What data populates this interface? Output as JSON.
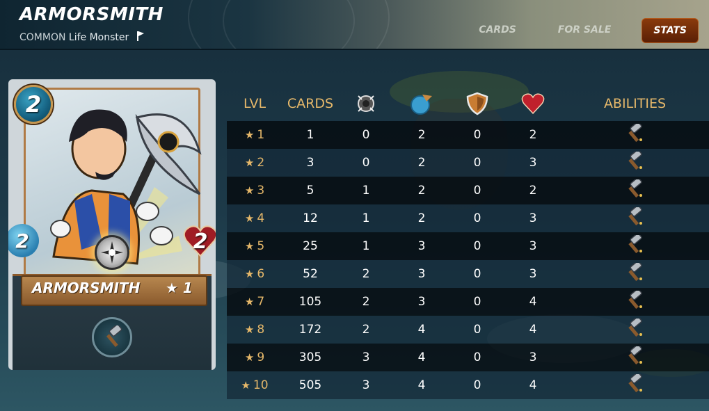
{
  "header": {
    "title": "ARMORSMITH",
    "rarity": "COMMON",
    "subtitle_rest": "Life Monster",
    "tabs": [
      {
        "label": "CARDS",
        "active": false
      },
      {
        "label": "FOR SALE",
        "active": false
      },
      {
        "label": "STATS",
        "active": true
      }
    ]
  },
  "card": {
    "name": "ARMORSMITH",
    "level": "★ 1",
    "mana": "2",
    "speed": "2",
    "health": "2",
    "element_icon": "life-element-icon",
    "ability_icon": "repair-hammer-icon"
  },
  "stats": {
    "headers": {
      "lvl": "LVL",
      "cards": "CARDS",
      "attack_icon": "melee-attack-icon",
      "speed_icon": "speed-icon",
      "armor_icon": "armor-shield-icon",
      "health_icon": "health-heart-icon",
      "abilities": "ABILITIES"
    },
    "rows": [
      {
        "lvl": "1",
        "cards": "1",
        "attack": "0",
        "speed": "2",
        "armor": "0",
        "health": "2"
      },
      {
        "lvl": "2",
        "cards": "3",
        "attack": "0",
        "speed": "2",
        "armor": "0",
        "health": "3"
      },
      {
        "lvl": "3",
        "cards": "5",
        "attack": "1",
        "speed": "2",
        "armor": "0",
        "health": "2"
      },
      {
        "lvl": "4",
        "cards": "12",
        "attack": "1",
        "speed": "2",
        "armor": "0",
        "health": "3"
      },
      {
        "lvl": "5",
        "cards": "25",
        "attack": "1",
        "speed": "3",
        "armor": "0",
        "health": "3"
      },
      {
        "lvl": "6",
        "cards": "52",
        "attack": "2",
        "speed": "3",
        "armor": "0",
        "health": "3"
      },
      {
        "lvl": "7",
        "cards": "105",
        "attack": "2",
        "speed": "3",
        "armor": "0",
        "health": "4"
      },
      {
        "lvl": "8",
        "cards": "172",
        "attack": "2",
        "speed": "4",
        "armor": "0",
        "health": "4"
      },
      {
        "lvl": "9",
        "cards": "305",
        "attack": "3",
        "speed": "4",
        "armor": "0",
        "health": "3"
      },
      {
        "lvl": "10",
        "cards": "505",
        "attack": "3",
        "speed": "4",
        "armor": "0",
        "health": "4"
      }
    ]
  },
  "colors": {
    "accent_gold": "#e6b86a",
    "active_tab": "#8a3a0c",
    "row_odd": "#142a38",
    "row_even": "#060c10"
  }
}
